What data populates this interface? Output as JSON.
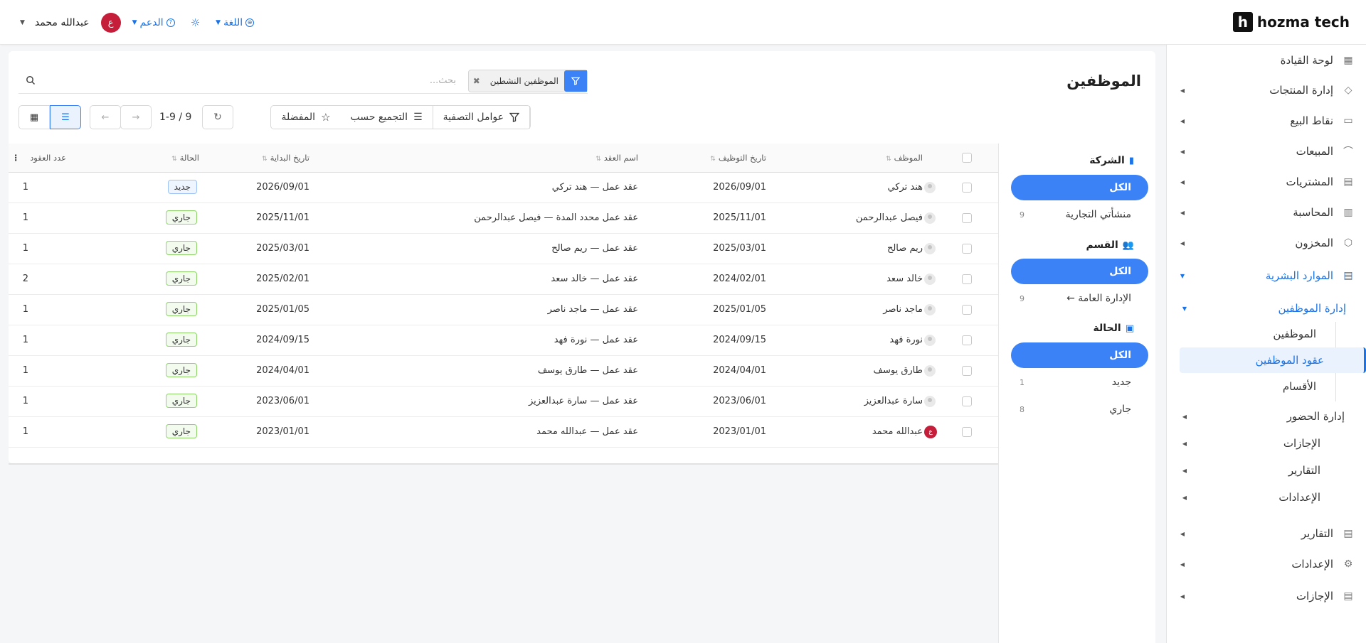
{
  "brand": {
    "logo_letter": "h",
    "name": "hozma tech"
  },
  "header": {
    "user_name": "عبدالله محمد",
    "avatar_initial": "ع",
    "support_label": "الدعم",
    "language_label": "اللغة"
  },
  "sidebar": {
    "items": [
      {
        "label": "لوحة القيادة",
        "icon": "dashboard-icon"
      },
      {
        "label": "إدارة المنتجات",
        "icon": "tag-icon"
      },
      {
        "label": "نقاط البيع",
        "icon": "store-icon"
      },
      {
        "label": "المبيعات",
        "icon": "chart-icon"
      },
      {
        "label": "المشتريات",
        "icon": "cart-icon"
      },
      {
        "label": "المحاسبة",
        "icon": "ledger-icon"
      },
      {
        "label": "المخزون",
        "icon": "box-icon"
      },
      {
        "label": "الموارد البشرية",
        "icon": "document-icon"
      }
    ],
    "hr_sub": {
      "group_label": "إدارة الموظفين",
      "children": [
        "الموظفين",
        "عقود الموظفين",
        "الأقسام"
      ],
      "others": [
        "إدارة الحضور",
        "الإجازات",
        "التقارير",
        "الإعدادات"
      ]
    },
    "bottom_items": [
      {
        "label": "التقارير",
        "icon": "report-icon"
      },
      {
        "label": "الإعدادات",
        "icon": "gear-icon"
      },
      {
        "label": "الإجازات",
        "icon": "document-icon"
      }
    ]
  },
  "main": {
    "title": "الموظفين",
    "search_placeholder": "بحث...",
    "facet_label": "الموظفين النشطين",
    "filters_label": "عوامل التصفية",
    "group_by_label": "التجميع حسب",
    "favorites_label": "المفضلة",
    "pager": "1-9 / 9"
  },
  "facets": {
    "company": {
      "title": "الشركة",
      "all": "الكل",
      "rows": [
        {
          "label": "منشأتي التجارية",
          "count": "9"
        }
      ]
    },
    "department": {
      "title": "القسم",
      "all": "الكل",
      "rows": [
        {
          "label": "الإدارة العامة ←",
          "count": "9"
        }
      ]
    },
    "status": {
      "title": "الحالة",
      "all": "الكل",
      "rows": [
        {
          "label": "جديد",
          "count": "1"
        },
        {
          "label": "جاري",
          "count": "8"
        }
      ]
    }
  },
  "table": {
    "columns": [
      "الموظف",
      "تاريخ التوظيف",
      "اسم العقد",
      "تاريخ البداية",
      "الحالة",
      "عدد العقود"
    ],
    "rows": [
      {
        "employee": "هند تركي",
        "hire_date": "2026/09/01",
        "contract": "عقد عمل — هند تركي",
        "start": "2026/09/01",
        "status": "جديد",
        "count": "1"
      },
      {
        "employee": "فيصل عبدالرحمن",
        "hire_date": "2025/11/01",
        "contract": "عقد عمل محدد المدة — فيصل عبدالرحمن",
        "start": "2025/11/01",
        "status": "جاري",
        "count": "1"
      },
      {
        "employee": "ريم صالح",
        "hire_date": "2025/03/01",
        "contract": "عقد عمل — ريم صالح",
        "start": "2025/03/01",
        "status": "جاري",
        "count": "1"
      },
      {
        "employee": "خالد سعد",
        "hire_date": "2024/02/01",
        "contract": "عقد عمل — خالد سعد",
        "start": "2025/02/01",
        "status": "جاري",
        "count": "2"
      },
      {
        "employee": "ماجد ناصر",
        "hire_date": "2025/01/05",
        "contract": "عقد عمل — ماجد ناصر",
        "start": "2025/01/05",
        "status": "جاري",
        "count": "1"
      },
      {
        "employee": "نورة فهد",
        "hire_date": "2024/09/15",
        "contract": "عقد عمل — نورة فهد",
        "start": "2024/09/15",
        "status": "جاري",
        "count": "1"
      },
      {
        "employee": "طارق يوسف",
        "hire_date": "2024/04/01",
        "contract": "عقد عمل — طارق يوسف",
        "start": "2024/04/01",
        "status": "جاري",
        "count": "1"
      },
      {
        "employee": "سارة عبدالعزيز",
        "hire_date": "2023/06/01",
        "contract": "عقد عمل — سارة عبدالعزيز",
        "start": "2023/06/01",
        "status": "جاري",
        "count": "1"
      },
      {
        "employee": "عبدالله محمد",
        "hire_date": "2023/01/01",
        "contract": "عقد عمل — عبدالله محمد",
        "start": "2023/01/01",
        "status": "جاري",
        "count": "1",
        "avatar": "ع"
      }
    ]
  },
  "colors": {
    "accent": "#3b82f6",
    "avatar": "#c41e3a",
    "new_badge": "#9cc2f5",
    "running_badge": "#8ed46b"
  }
}
